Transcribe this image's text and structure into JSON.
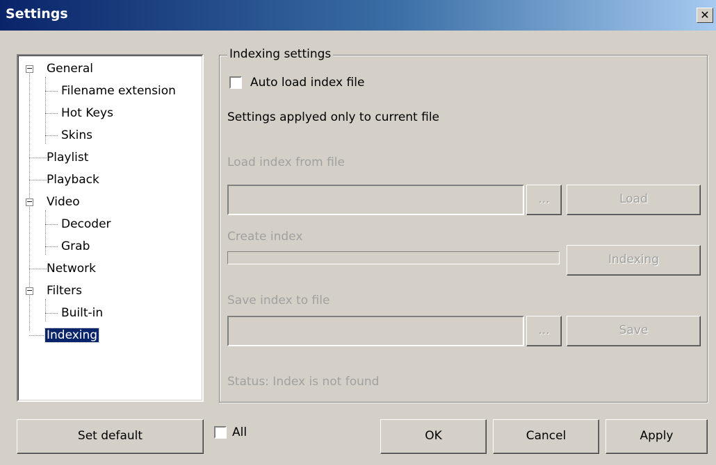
{
  "window": {
    "title": "Settings",
    "close_glyph": "✕"
  },
  "tree": {
    "items": [
      {
        "label": "General",
        "expanded": true
      },
      {
        "label": "Filename extension"
      },
      {
        "label": "Hot Keys"
      },
      {
        "label": "Skins"
      },
      {
        "label": "Playlist"
      },
      {
        "label": "Playback"
      },
      {
        "label": "Video",
        "expanded": true
      },
      {
        "label": "Decoder"
      },
      {
        "label": "Grab"
      },
      {
        "label": "Network"
      },
      {
        "label": "Filters",
        "expanded": true
      },
      {
        "label": "Built-in"
      },
      {
        "label": "Indexing",
        "selected": true
      }
    ]
  },
  "panel": {
    "group_title": "Indexing settings",
    "auto_load_label": "Auto load index file",
    "auto_load_checked": false,
    "note": "Settings applyed only to current file",
    "load_label": "Load index from file",
    "load_path_value": "",
    "browse1": "...",
    "load_button": "Load",
    "create_label": "Create index",
    "create_progress": 0,
    "indexing_button": "Indexing",
    "save_label": "Save index to file",
    "save_path_value": "",
    "browse2": "...",
    "save_button": "Save",
    "status": "Status: Index is not found"
  },
  "footer": {
    "set_default": "Set default",
    "all_label": "All",
    "all_checked": false,
    "ok": "OK",
    "cancel": "Cancel",
    "apply": "Apply"
  }
}
